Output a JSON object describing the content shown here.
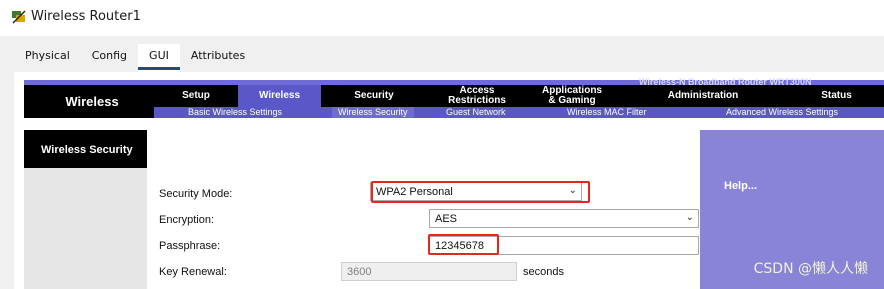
{
  "window": {
    "title": "Wireless Router1"
  },
  "tabs": [
    {
      "label": "Physical",
      "active": false
    },
    {
      "label": "Config",
      "active": false
    },
    {
      "label": "GUI",
      "active": true
    },
    {
      "label": "Attributes",
      "active": false
    }
  ],
  "gui": {
    "model_strip": "Wireless-N Broadband Router     WRT300N",
    "brand": "Wireless",
    "nav": [
      {
        "label": "Setup",
        "active": false
      },
      {
        "label": "Wireless",
        "active": true
      },
      {
        "label": "Security",
        "active": false
      },
      {
        "label": "Access\nRestrictions",
        "active": false
      },
      {
        "label": "Applications\n& Gaming",
        "active": false
      },
      {
        "label": "Administration",
        "active": false
      },
      {
        "label": "Status",
        "active": false
      }
    ],
    "subnav": [
      {
        "label": "Basic Wireless Settings",
        "active": false
      },
      {
        "label": "Wireless Security",
        "active": true
      },
      {
        "label": "Guest Network",
        "active": false
      },
      {
        "label": "Wireless MAC Filter",
        "active": false
      },
      {
        "label": "Advanced Wireless Settings",
        "active": false
      }
    ],
    "section_title": "Wireless Security",
    "form": {
      "security_mode_label": "Security Mode:",
      "security_mode_value": "WPA2 Personal",
      "encryption_label": "Encryption:",
      "encryption_value": "AES",
      "passphrase_label": "Passphrase:",
      "passphrase_value": "12345678",
      "key_renewal_label": "Key Renewal:",
      "key_renewal_value": "3600",
      "key_renewal_unit": "seconds"
    },
    "help": "Help...",
    "colors": {
      "nav_bg": "#000000",
      "accent": "#5a58c8",
      "help_bg": "#8a84d8",
      "highlight": "#e8261c"
    }
  },
  "watermark": "CSDN @懒人人懒"
}
